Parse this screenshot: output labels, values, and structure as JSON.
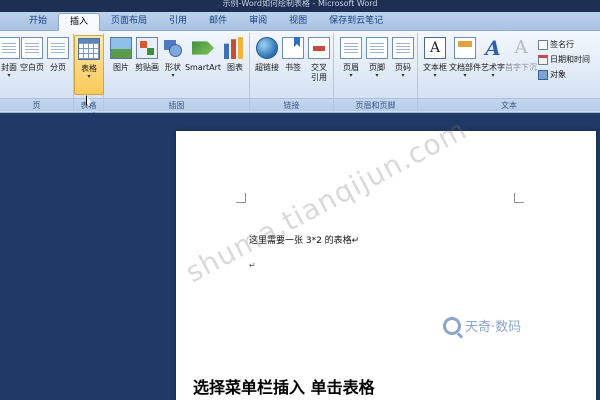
{
  "window": {
    "title": "示例-Word如何绘制表格 - Microsoft Word"
  },
  "tabs": [
    {
      "label": "开始",
      "active": false
    },
    {
      "label": "插入",
      "active": true
    },
    {
      "label": "页面布局",
      "active": false
    },
    {
      "label": "引用",
      "active": false
    },
    {
      "label": "邮件",
      "active": false
    },
    {
      "label": "审阅",
      "active": false
    },
    {
      "label": "视图",
      "active": false
    },
    {
      "label": "保存到云笔记",
      "active": false
    }
  ],
  "ribbon": {
    "groups": {
      "pages": {
        "label": "页",
        "buttons": [
          "封面",
          "空白页",
          "分页"
        ]
      },
      "tables": {
        "label": "表格",
        "buttons": [
          "表格"
        ]
      },
      "illustrations": {
        "label": "插图",
        "buttons": [
          "图片",
          "剪贴画",
          "形状",
          "SmartArt",
          "图表"
        ]
      },
      "links": {
        "label": "链接",
        "buttons": [
          "超链接",
          "书签",
          "交叉",
          "引用"
        ]
      },
      "header_footer": {
        "label": "页眉和页脚",
        "buttons": [
          "页眉",
          "页脚",
          "页码"
        ]
      },
      "text": {
        "label": "文本",
        "buttons": [
          "文本框",
          "文档部件",
          "艺术字",
          "首字下沉"
        ],
        "small_buttons": [
          "签名行",
          "日期和时间",
          "对象"
        ]
      }
    }
  },
  "document": {
    "line1": "这里需要一张 3*2 的表格↵",
    "line2": "↵"
  },
  "overlay": {
    "watermark": "shuma.tianqijun.com",
    "brand": "天奇·数码",
    "caption": "选择菜单栏插入 单击表格"
  },
  "colors": {
    "accent": "#f9c95a",
    "ribbon_text": "#15428b",
    "workspace": "#1f3a66",
    "arrow": "#e8733a"
  }
}
